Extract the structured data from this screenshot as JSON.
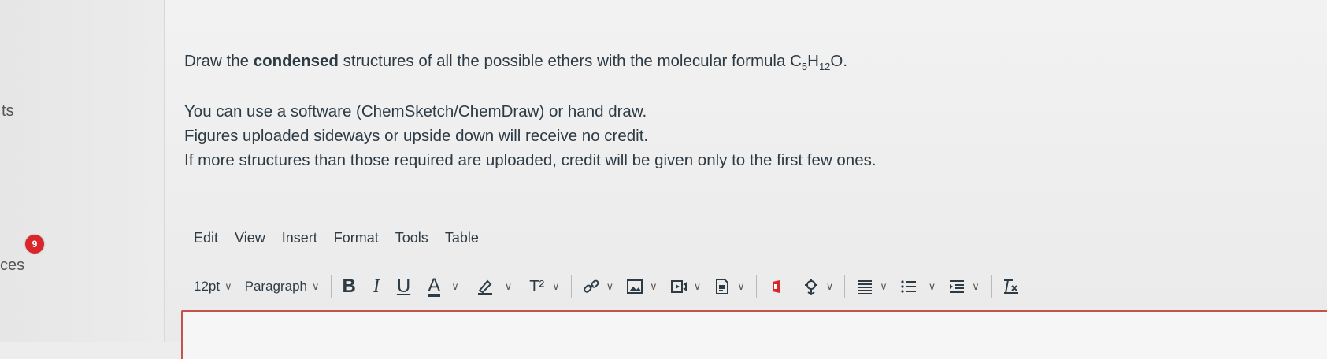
{
  "nav": {
    "fragment_top": "ts",
    "fragment_bottom": "ces",
    "badge_count": "9"
  },
  "question": {
    "line1_prefix": "Draw the ",
    "line1_bold": "condensed",
    "line1_middle": " structures of all the possible ethers with the molecular formula C",
    "sub1": "5",
    "mid_h": "H",
    "sub2": "12",
    "line1_end": "O.",
    "lines": [
      "You can use a software (ChemSketch/ChemDraw) or hand draw.",
      "Figures uploaded sideways or upside down will receive no credit.",
      "If more structures than those required are uploaded, credit will be given only to the first few ones."
    ]
  },
  "menubar": {
    "items": [
      "Edit",
      "View",
      "Insert",
      "Format",
      "Tools",
      "Table"
    ]
  },
  "toolbar": {
    "font_size": "12pt",
    "block_format": "Paragraph",
    "bold": "B",
    "italic": "I",
    "underline": "U",
    "text_color": "A",
    "superscript": "T²",
    "chevron": "∨",
    "accent_color": "#2d3b45",
    "editor_border_color": "#c4534d"
  }
}
